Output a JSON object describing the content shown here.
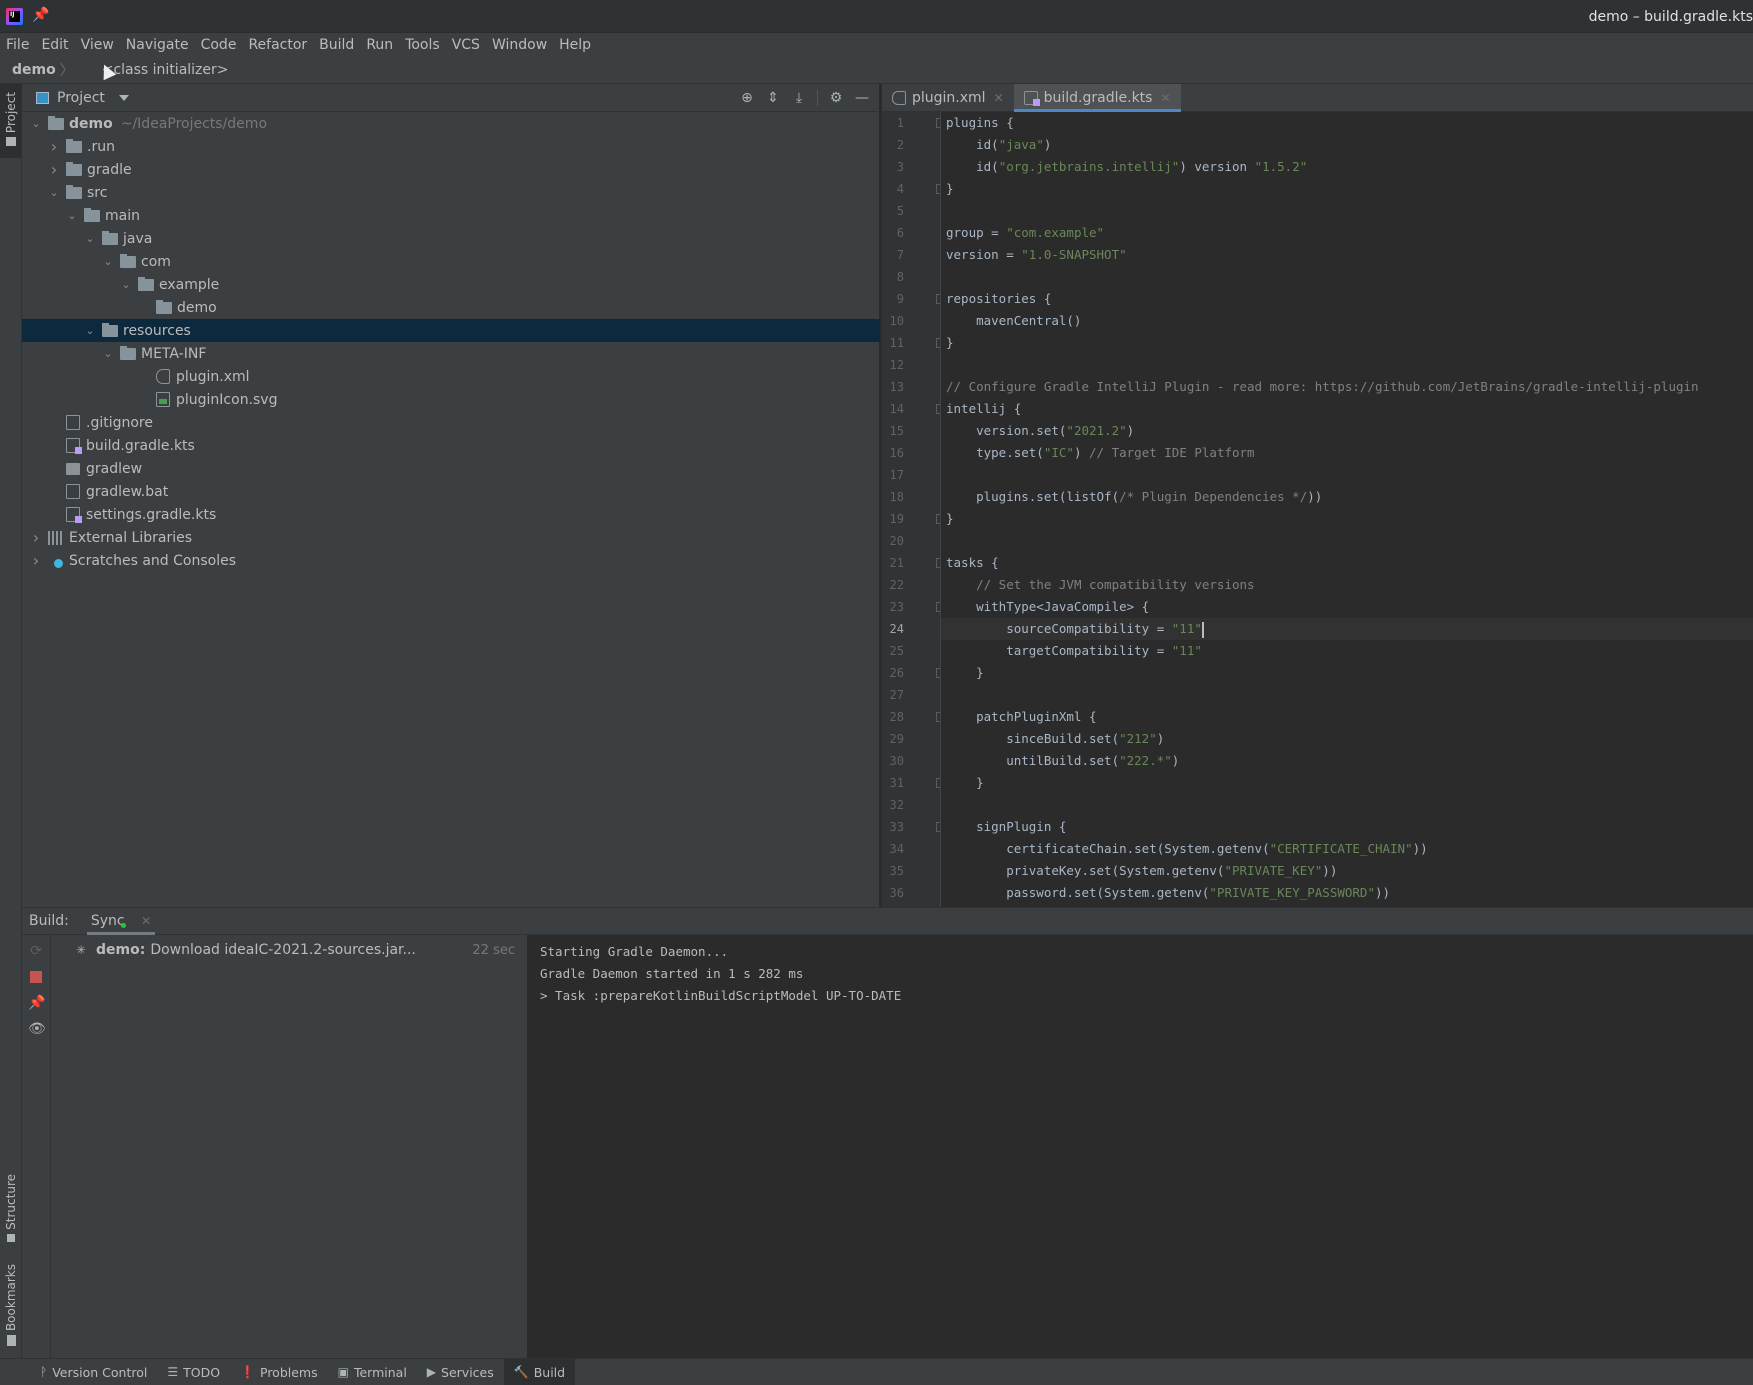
{
  "titlebar": {
    "window_title": "demo – build.gradle.kts"
  },
  "menu": [
    "File",
    "Edit",
    "View",
    "Navigate",
    "Code",
    "Refactor",
    "Build",
    "Run",
    "Tools",
    "VCS",
    "Window",
    "Help"
  ],
  "breadcrumb": {
    "project": "demo",
    "separator": "〉",
    "item": "<class initializer>"
  },
  "left_stripe": {
    "project": "Project",
    "structure": "Structure",
    "bookmarks": "Bookmarks"
  },
  "project_panel": {
    "title": "Project",
    "tools": [
      "locate-icon",
      "expand-all-icon",
      "collapse-all-icon",
      "gear-icon",
      "hide-icon"
    ],
    "tree": [
      {
        "label": "demo",
        "hint": "~/IdeaProjects/demo",
        "depth": 0,
        "chevron": "down",
        "icon": "module"
      },
      {
        "label": ".run",
        "depth": 1,
        "chevron": "right",
        "icon": "folder"
      },
      {
        "label": "gradle",
        "depth": 1,
        "chevron": "right",
        "icon": "folder"
      },
      {
        "label": "src",
        "depth": 1,
        "chevron": "down",
        "icon": "folder"
      },
      {
        "label": "main",
        "depth": 2,
        "chevron": "down",
        "icon": "folder"
      },
      {
        "label": "java",
        "depth": 3,
        "chevron": "down",
        "icon": "folder"
      },
      {
        "label": "com",
        "depth": 4,
        "chevron": "down",
        "icon": "folder"
      },
      {
        "label": "example",
        "depth": 5,
        "chevron": "down",
        "icon": "folder"
      },
      {
        "label": "demo",
        "depth": 6,
        "chevron": "",
        "icon": "folder"
      },
      {
        "label": "resources",
        "depth": 3,
        "chevron": "down",
        "icon": "folder",
        "selected": true
      },
      {
        "label": "META-INF",
        "depth": 4,
        "chevron": "down",
        "icon": "folder"
      },
      {
        "label": "plugin.xml",
        "depth": 6,
        "chevron": "",
        "icon": "xml"
      },
      {
        "label": "pluginIcon.svg",
        "depth": 6,
        "chevron": "",
        "icon": "svg"
      },
      {
        "label": ".gitignore",
        "depth": 1,
        "chevron": "",
        "icon": "ignore"
      },
      {
        "label": "build.gradle.kts",
        "depth": 1,
        "chevron": "",
        "icon": "kts"
      },
      {
        "label": "gradlew",
        "depth": 1,
        "chevron": "",
        "icon": "exec"
      },
      {
        "label": "gradlew.bat",
        "depth": 1,
        "chevron": "",
        "icon": "text"
      },
      {
        "label": "settings.gradle.kts",
        "depth": 1,
        "chevron": "",
        "icon": "kts"
      },
      {
        "label": "External Libraries",
        "depth": 0,
        "chevron": "right",
        "icon": "libs"
      },
      {
        "label": "Scratches and Consoles",
        "depth": 0,
        "chevron": "right",
        "icon": "scratch"
      }
    ]
  },
  "editor": {
    "tabs": [
      {
        "label": "plugin.xml",
        "active": false,
        "icon": "xml"
      },
      {
        "label": "build.gradle.kts",
        "active": true,
        "icon": "kts"
      }
    ],
    "current_line": 24,
    "lines": [
      [
        [
          "plugins {",
          ""
        ]
      ],
      [
        [
          "    id(",
          ""
        ],
        [
          "\"java\"",
          "str"
        ],
        [
          ")",
          ""
        ]
      ],
      [
        [
          "    id(",
          ""
        ],
        [
          "\"org.jetbrains.intellij\"",
          "str"
        ],
        [
          ") version ",
          ""
        ],
        [
          "\"1.5.2\"",
          "str"
        ]
      ],
      [
        [
          "}",
          ""
        ]
      ],
      [],
      [
        [
          "group = ",
          ""
        ],
        [
          "\"com.example\"",
          "str"
        ]
      ],
      [
        [
          "version = ",
          ""
        ],
        [
          "\"1.0-SNAPSHOT\"",
          "str"
        ]
      ],
      [],
      [
        [
          "repositories {",
          ""
        ]
      ],
      [
        [
          "    mavenCentral()",
          ""
        ]
      ],
      [
        [
          "}",
          ""
        ]
      ],
      [],
      [
        [
          "// Configure Gradle IntelliJ Plugin - read more: https://github.com/JetBrains/gradle-intellij-plugin",
          "cmt"
        ]
      ],
      [
        [
          "intellij {",
          ""
        ]
      ],
      [
        [
          "    version.set(",
          ""
        ],
        [
          "\"2021.2\"",
          "str"
        ],
        [
          ")",
          ""
        ]
      ],
      [
        [
          "    type.set(",
          ""
        ],
        [
          "\"IC\"",
          "str"
        ],
        [
          ") ",
          ""
        ],
        [
          "// Target IDE Platform",
          "cmt"
        ]
      ],
      [],
      [
        [
          "    plugins.set(listOf(",
          ""
        ],
        [
          "/* Plugin Dependencies */",
          "cmt"
        ],
        [
          "))",
          ""
        ]
      ],
      [
        [
          "}",
          ""
        ]
      ],
      [],
      [
        [
          "tasks {",
          ""
        ]
      ],
      [
        [
          "    ",
          ""
        ],
        [
          "// Set the JVM compatibility versions",
          "cmt"
        ]
      ],
      [
        [
          "    withType<JavaCompile> {",
          ""
        ]
      ],
      [
        [
          "        sourceCompatibility = ",
          ""
        ],
        [
          "\"11\"",
          "str"
        ]
      ],
      [
        [
          "        targetCompatibility = ",
          ""
        ],
        [
          "\"11\"",
          "str"
        ]
      ],
      [
        [
          "    }",
          ""
        ]
      ],
      [],
      [
        [
          "    patchPluginXml {",
          ""
        ]
      ],
      [
        [
          "        sinceBuild.set(",
          ""
        ],
        [
          "\"212\"",
          "str"
        ],
        [
          ")",
          ""
        ]
      ],
      [
        [
          "        untilBuild.set(",
          ""
        ],
        [
          "\"222.*\"",
          "str"
        ],
        [
          ")",
          ""
        ]
      ],
      [
        [
          "    }",
          ""
        ]
      ],
      [],
      [
        [
          "    signPlugin {",
          ""
        ]
      ],
      [
        [
          "        certificateChain.set(System.getenv(",
          ""
        ],
        [
          "\"CERTIFICATE_CHAIN\"",
          "str"
        ],
        [
          "))",
          ""
        ]
      ],
      [
        [
          "        privateKey.set(System.getenv(",
          ""
        ],
        [
          "\"PRIVATE_KEY\"",
          "str"
        ],
        [
          "))",
          ""
        ]
      ],
      [
        [
          "        password.set(System.getenv(",
          ""
        ],
        [
          "\"PRIVATE_KEY_PASSWORD\"",
          "str"
        ],
        [
          "))",
          ""
        ]
      ]
    ],
    "fold_lines": [
      1,
      4,
      9,
      11,
      14,
      19,
      21,
      23,
      26,
      28,
      31,
      33
    ]
  },
  "build": {
    "label": "Build:",
    "tab": "Sync",
    "row": {
      "project": "demo:",
      "text": "Download ideaIC-2021.2-sources.jar...",
      "time": "22 sec"
    },
    "console": [
      "Starting Gradle Daemon...",
      "Gradle Daemon started in 1 s 282 ms",
      "> Task :prepareKotlinBuildScriptModel UP-TO-DATE"
    ]
  },
  "bottom_bar": [
    {
      "label": "Version Control",
      "icon": "ᚹ",
      "active": false
    },
    {
      "label": "TODO",
      "icon": "☰",
      "active": false
    },
    {
      "label": "Problems",
      "icon": "❗",
      "active": false
    },
    {
      "label": "Terminal",
      "icon": "▣",
      "active": false
    },
    {
      "label": "Services",
      "icon": "▶",
      "active": false
    },
    {
      "label": "Build",
      "icon": "🔨",
      "active": true
    }
  ]
}
